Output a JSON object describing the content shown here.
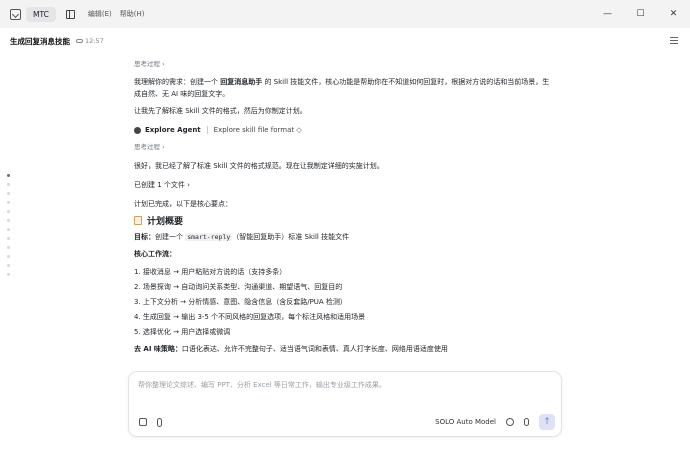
{
  "titlebar": {
    "app_name": "MTC",
    "menus": [
      "编辑(E)",
      "帮助(H)"
    ],
    "controls": [
      "—",
      "☐",
      "✕"
    ]
  },
  "conversation": {
    "title": "生成回复消息技能",
    "time": "12:57"
  },
  "messages": {
    "think1": "思考过程 ›",
    "para1_a": "我理解你的需求：创建一个 ",
    "para1_b": "回复消息助手",
    "para1_c": " 的 Skill 技能文件，核心功能是帮助你在不知道如何回复时，根据对方说的话和当前场景，生成自然、无 AI 味的回复文字。",
    "para2": "让我先了解标准 Skill 文件的格式，然后为你制定计划。",
    "agent_name": "Explore Agent",
    "agent_task": "Explore skill file format ◇",
    "think2": "思考过程 ›",
    "para3": "很好，我已经了解了标准 Skill 文件的格式规范。现在让我制定详细的实施计划。",
    "created": "已创建 1 个文件 ›",
    "para4": "计划已完成，以下是核心要点：",
    "plan_title": "计划概要",
    "goal_label": "目标：",
    "goal_a": "创建一个 ",
    "goal_code": "smart-reply",
    "goal_b": "（智能回复助手）标准 Skill 技能文件",
    "flow_label": "核心工作流：",
    "steps": [
      "1. 接收消息 → 用户粘贴对方说的话（支持多条）",
      "2. 场景探询 → 自动询问关系类型、沟通渠道、期望语气、回复目的",
      "3. 上下文分析 → 分析情感、意图、隐含信息（含反套路/PUA 检测）",
      "4. 生成回复 → 输出 3-5 个不同风格的回复选项，每个标注风格和适用场景",
      "5. 选择优化 → 用户选择或微调"
    ],
    "strategy_label": "去 AI 味策略：",
    "strategy": "口语化表达、允许不完整句子、适当语气词和表情、真人打字长度、网络用语适度使用"
  },
  "input": {
    "placeholder": "帮你整理论文综述、编写 PPT、分析 Excel 等日常工作，输出专业级工作成果。",
    "model": "SOLO Auto Model",
    "send_icon": "↑"
  }
}
